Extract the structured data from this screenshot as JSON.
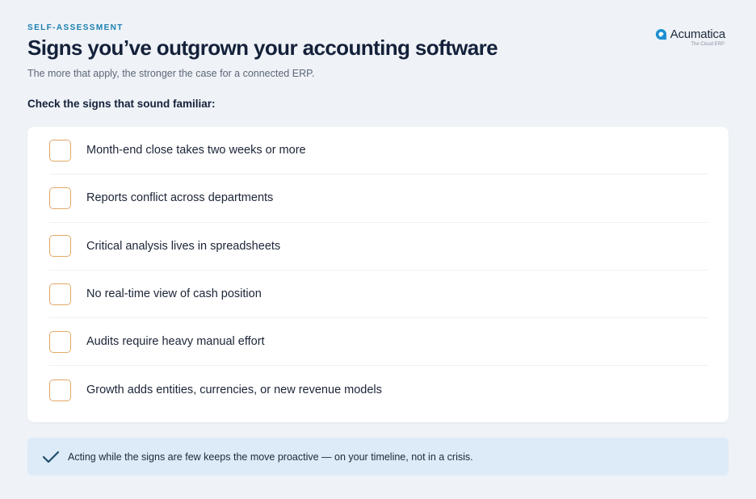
{
  "header": {
    "eyebrow": "SELF-ASSESSMENT",
    "title": "Signs you’ve outgrown your accounting software",
    "subtitle": "The more that apply, the stronger the case for a connected ERP."
  },
  "logo": {
    "name": "Acumatica",
    "tagline": "The Cloud ERP",
    "icon": "acumatica-logo-mark",
    "color": "#1a8fd1"
  },
  "checklist": {
    "prompt": "Check the signs that sound familiar:",
    "checkbox_color": "#e2a866",
    "items": [
      {
        "label": "Month-end close takes two weeks or more",
        "checked": false
      },
      {
        "label": "Reports conflict across departments",
        "checked": false
      },
      {
        "label": "Critical analysis lives in spreadsheets",
        "checked": false
      },
      {
        "label": "No real-time view of cash position",
        "checked": false
      },
      {
        "label": "Audits require heavy manual effort",
        "checked": false
      },
      {
        "label": "Growth adds entities, currencies, or new revenue models",
        "checked": false
      }
    ]
  },
  "callout": {
    "icon": "checkmark-icon",
    "text": "Acting while the signs are few keeps the move proactive — on your timeline, not in a crisis.",
    "background": "#dcebf7"
  }
}
